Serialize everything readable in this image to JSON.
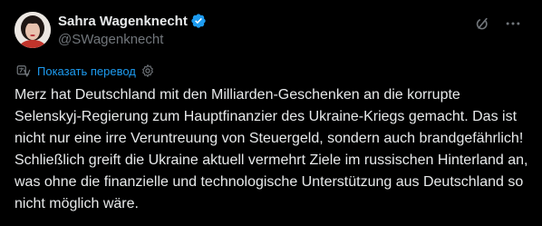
{
  "author": {
    "display_name": "Sahra Wagenknecht",
    "handle": "@SWagenknecht",
    "verified": true
  },
  "actions": {
    "grok_icon": "grok-icon",
    "more_icon": "more-options-icon"
  },
  "translation": {
    "label": "Показать перевод",
    "icon": "translate-icon",
    "settings_icon": "gear-icon"
  },
  "tweet": {
    "text": "Merz hat Deutschland mit den Milliarden-Geschenken an die korrupte Selenskyj-Regierung zum Hauptfinanzier des Ukraine-Kriegs gemacht. Das ist nicht nur eine irre Veruntreuung von Steuergeld, sondern auch brandgefährlich! Schließlich greift die Ukraine aktuell vermehrt Ziele im russischen Hinterland an, was ohne die finanzielle und technologische Unterstützung aus Deutschland so nicht möglich wäre."
  },
  "colors": {
    "background": "#000000",
    "text_primary": "#e7e9ea",
    "text_secondary": "#71767b",
    "accent_blue": "#1d9bf0"
  }
}
